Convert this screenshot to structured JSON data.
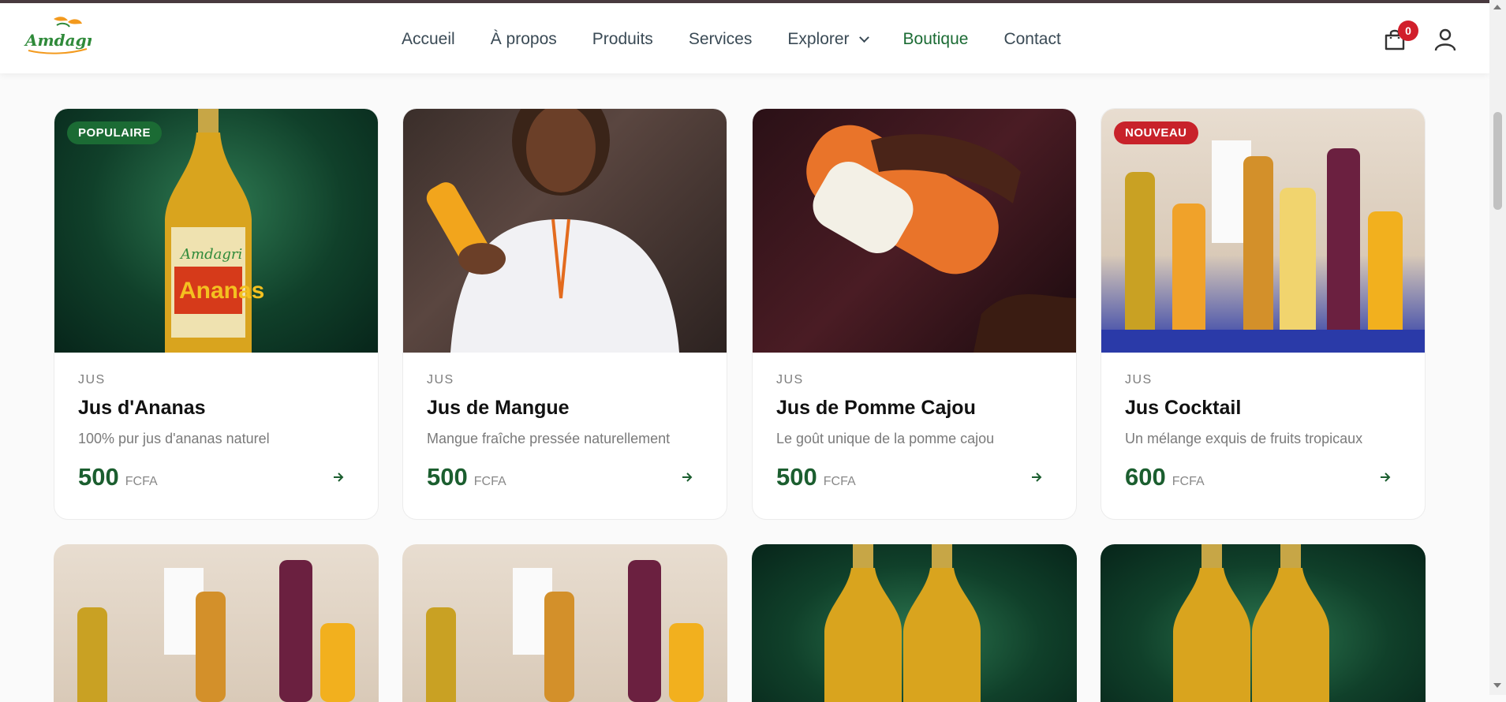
{
  "brand": {
    "logo_text": "Amdagri"
  },
  "nav": {
    "items": [
      {
        "label": "Accueil"
      },
      {
        "label": "À propos"
      },
      {
        "label": "Produits"
      },
      {
        "label": "Services"
      },
      {
        "label": "Explorer"
      },
      {
        "label": "Boutique"
      },
      {
        "label": "Contact"
      }
    ],
    "active": "Boutique"
  },
  "cart": {
    "count": "0"
  },
  "colors": {
    "brand_green": "#1b5e2f",
    "badge_red": "#d11f2b",
    "popular_green": "#1b6b34"
  },
  "products": [
    {
      "tag": "POPULAIRE",
      "tag_color": "#1b6b34",
      "category": "JUS",
      "name": "Jus d'Ananas",
      "description": "100% pur jus d'ananas naturel",
      "price": "500",
      "currency": "FCFA",
      "image": "pineapple-juice-bottle"
    },
    {
      "tag": "",
      "category": "JUS",
      "name": "Jus de Mangue",
      "description": "Mangue fraîche pressée naturellement",
      "price": "500",
      "currency": "FCFA",
      "image": "woman-holding-mango-juice"
    },
    {
      "tag": "",
      "category": "JUS",
      "name": "Jus de Pomme Cajou",
      "description": "Le goût unique de la pomme cajou",
      "price": "500",
      "currency": "FCFA",
      "image": "hand-holding-cashew-juice"
    },
    {
      "tag": "NOUVEAU",
      "tag_color": "#c8222a",
      "category": "JUS",
      "name": "Jus Cocktail",
      "description": "Un mélange exquis de fruits tropicaux",
      "price": "600",
      "currency": "FCFA",
      "image": "assorted-juice-bottles"
    }
  ]
}
